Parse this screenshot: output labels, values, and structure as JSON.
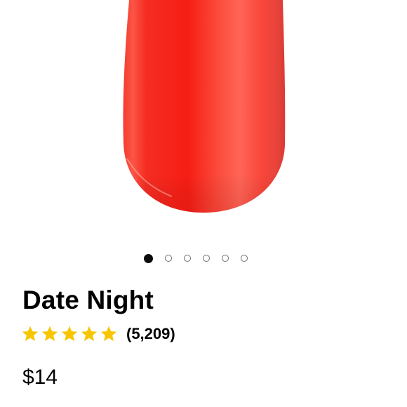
{
  "product": {
    "name": "Date Night",
    "review_count": "(5,209)",
    "rating": 5,
    "rating_max": 5,
    "price": "$14",
    "nail_color": "#f8312a",
    "star_color": "#f7c600"
  },
  "gallery": {
    "total_images": 6,
    "active_index": 0
  }
}
